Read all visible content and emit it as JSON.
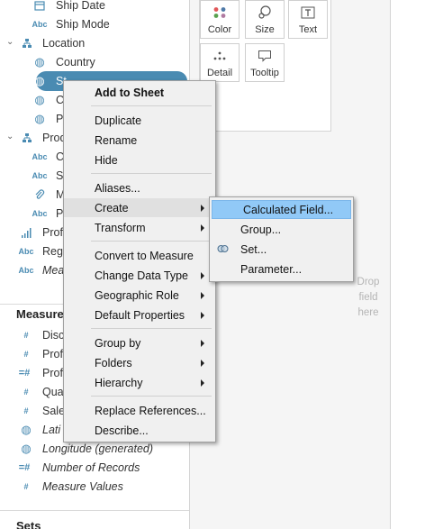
{
  "data_pane": {
    "rows": [
      {
        "label": "Ship Date",
        "icon": "calendar-icon",
        "italic": false
      },
      {
        "label": "Ship Mode",
        "icon": "abc-icon",
        "glyph": "Abc",
        "italic": false
      },
      {
        "label": "Location",
        "icon": "hierarchy-icon",
        "italic": false
      },
      {
        "label": "Country",
        "icon": "globe-icon",
        "italic": false
      },
      {
        "label": "St",
        "icon": "globe-icon",
        "italic": false
      },
      {
        "label": "C",
        "icon": "globe-icon",
        "italic": false
      },
      {
        "label": "P",
        "icon": "globe-icon",
        "italic": false
      },
      {
        "label": "Prod",
        "icon": "hierarchy-icon",
        "italic": false
      },
      {
        "label": "C",
        "icon": "abc-icon",
        "glyph": "Abc",
        "italic": false
      },
      {
        "label": "S",
        "icon": "abc-icon",
        "glyph": "Abc",
        "italic": false
      },
      {
        "label": "M",
        "icon": "paperclip-icon",
        "italic": false
      },
      {
        "label": "P",
        "icon": "abc-icon",
        "glyph": "Abc",
        "italic": false
      },
      {
        "label": "Prof",
        "icon": "bins-icon",
        "italic": false
      },
      {
        "label": "Reg",
        "icon": "abc-icon",
        "glyph": "Abc",
        "italic": false
      },
      {
        "label": "Meas",
        "icon": "abc-icon",
        "glyph": "Abc",
        "italic": true
      }
    ],
    "measures_header": "Measure",
    "measures": [
      {
        "label": "Disc",
        "icon": "hash-icon",
        "glyph": "#",
        "italic": false
      },
      {
        "label": "Prof",
        "icon": "hash-icon",
        "glyph": "#",
        "italic": false
      },
      {
        "label": "Prof",
        "icon": "calc-hash-icon",
        "glyph": "=#",
        "italic": false
      },
      {
        "label": "Qua",
        "icon": "hash-icon",
        "glyph": "#",
        "italic": false
      },
      {
        "label": "Sale",
        "icon": "hash-icon",
        "glyph": "#",
        "italic": false
      },
      {
        "label": "Lati",
        "icon": "globe-icon",
        "italic": true
      },
      {
        "label": "Longitude (generated)",
        "icon": "globe-icon",
        "italic": true
      },
      {
        "label": "Number of Records",
        "icon": "calc-hash-icon",
        "glyph": "=#",
        "italic": true
      },
      {
        "label": "Measure Values",
        "icon": "hash-icon",
        "glyph": "#",
        "italic": true
      }
    ],
    "sets_header": "Sets"
  },
  "marks": {
    "color_label": "Color",
    "size_label": "Size",
    "text_label": "Text",
    "detail_label": "Detail",
    "tooltip_label": "Tooltip"
  },
  "drop_hint": [
    "Drop",
    "field",
    "here"
  ],
  "context_menu": {
    "items": [
      {
        "label": "Add to Sheet",
        "bold": true,
        "submenu": false
      },
      {
        "label": "Duplicate",
        "submenu": false
      },
      {
        "label": "Rename",
        "submenu": false
      },
      {
        "label": "Hide",
        "submenu": false
      },
      {
        "label": "Aliases...",
        "submenu": false
      },
      {
        "label": "Create",
        "submenu": true,
        "highlighted": true
      },
      {
        "label": "Transform",
        "submenu": true
      },
      {
        "label": "Convert to Measure",
        "submenu": false
      },
      {
        "label": "Change Data Type",
        "submenu": true
      },
      {
        "label": "Geographic Role",
        "submenu": true
      },
      {
        "label": "Default Properties",
        "submenu": true
      },
      {
        "label": "Group by",
        "submenu": true
      },
      {
        "label": "Folders",
        "submenu": true
      },
      {
        "label": "Hierarchy",
        "submenu": true
      },
      {
        "label": "Replace References...",
        "submenu": false
      },
      {
        "label": "Describe...",
        "submenu": false
      }
    ]
  },
  "create_submenu": {
    "items": [
      {
        "label": "Calculated Field...",
        "highlighted": true
      },
      {
        "label": "Group..."
      },
      {
        "label": "Set...",
        "icon": "set-icon"
      },
      {
        "label": "Parameter..."
      }
    ]
  }
}
